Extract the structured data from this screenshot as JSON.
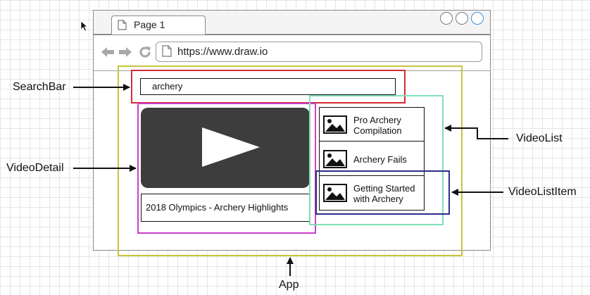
{
  "browser": {
    "tab_title": "Page 1",
    "url": "https://www.draw.io",
    "window_buttons": [
      "minimize-icon",
      "maximize-icon",
      "close-icon"
    ],
    "nav_icons": [
      "back-arrow-icon",
      "forward-arrow-icon",
      "refresh-icon"
    ]
  },
  "content": {
    "search_text": "archery",
    "video_title": "2018 Olympics - Archery Highlights",
    "list_items": [
      {
        "line1": "Pro Archery",
        "line2": "Compilation"
      },
      {
        "line1": "Archery Fails",
        "line2": ""
      },
      {
        "line1": "Getting Started",
        "line2": "with Archery"
      }
    ]
  },
  "labels": {
    "searchbar": "SearchBar",
    "videodetail": "VideoDetail",
    "videolist": "VideoList",
    "videolistitem": "VideoListItem",
    "app": "App"
  },
  "colors": {
    "app": "#c8c43a",
    "searchbar": "#d42a35",
    "videodetail": "#cc3fcc",
    "videolist": "#7ce0b4",
    "videolistitem": "#2c2c8c",
    "player": "#3d3d3d"
  }
}
